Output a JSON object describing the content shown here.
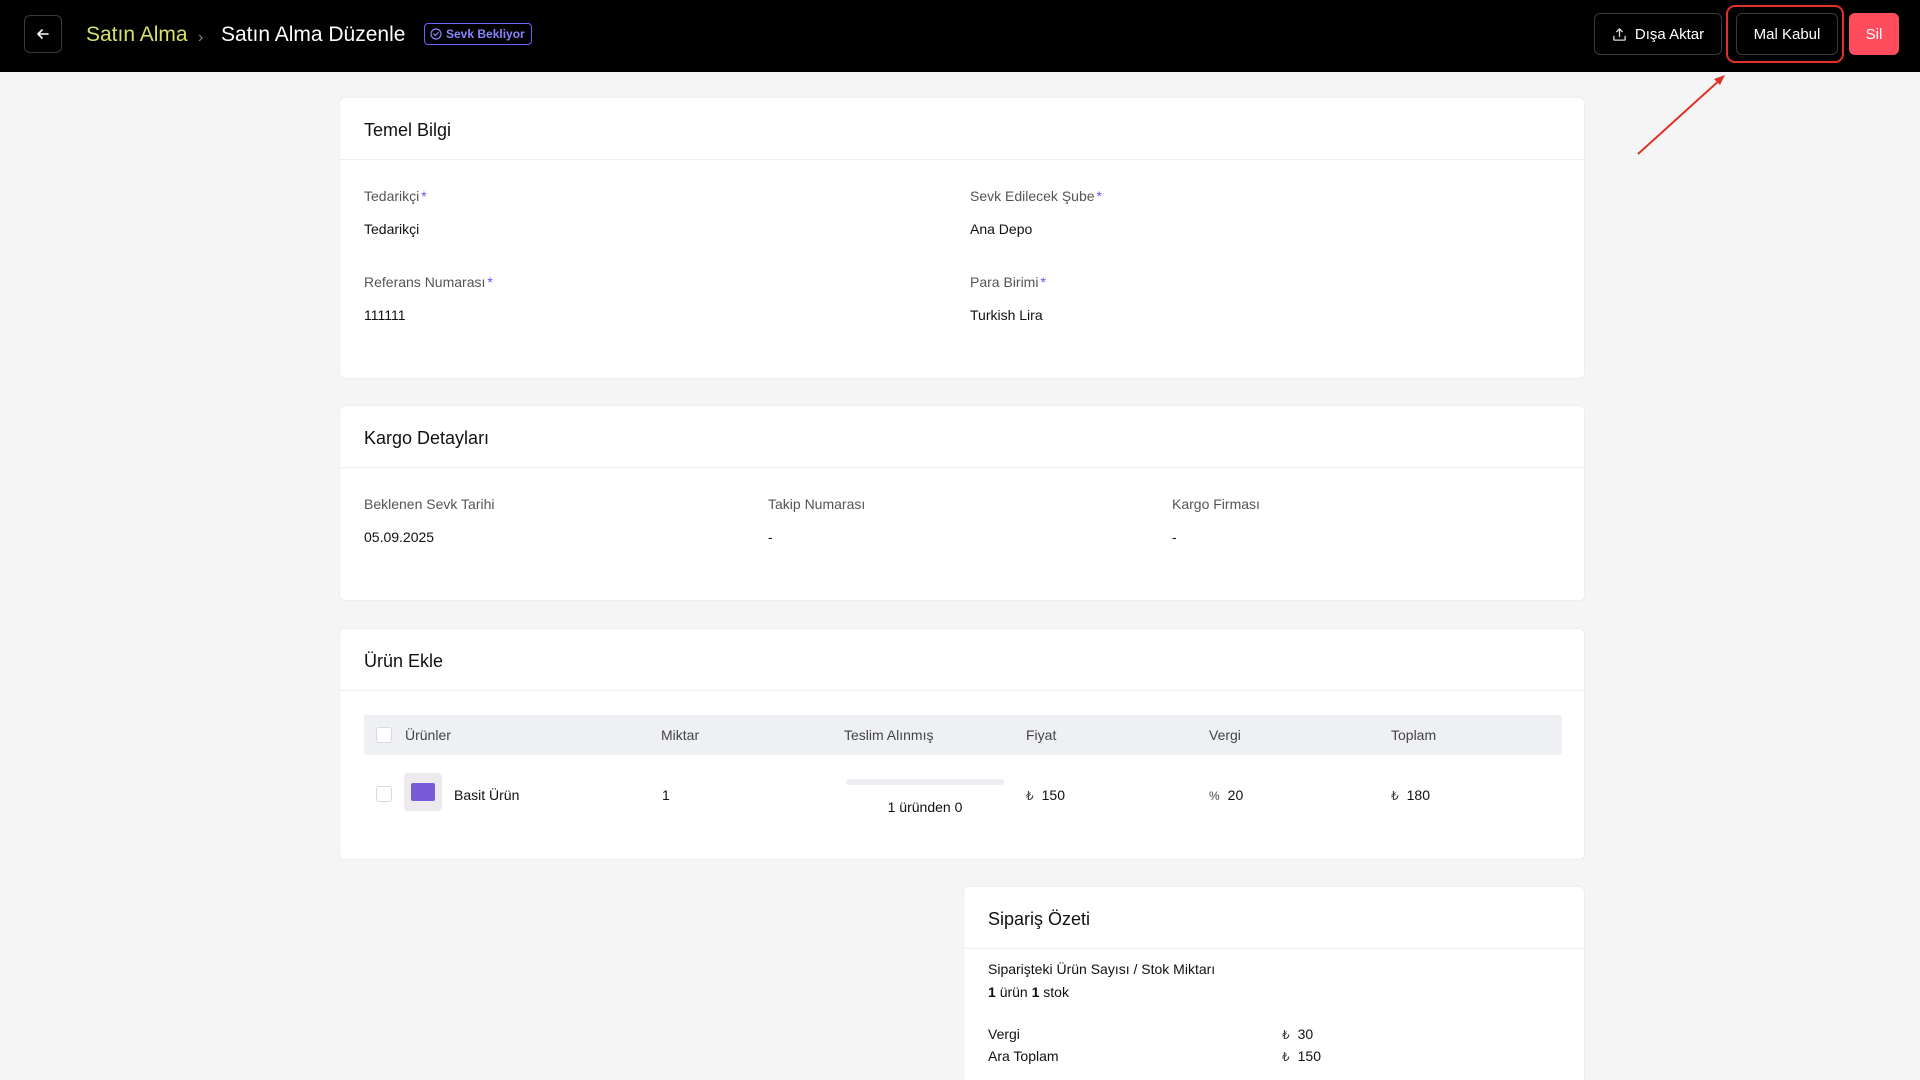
{
  "header": {
    "back_icon": "arrow-left-icon",
    "breadcrumb_parent": "Satın Alma",
    "breadcrumb_current": "Satın Alma Düzenle",
    "status_badge": "Sevk Bekliyor",
    "export_label": "Dışa Aktar",
    "accept_label": "Mal Kabul",
    "delete_label": "Sil"
  },
  "colors": {
    "topbar": "#000000",
    "breadcrumb_parent": "#d6e06a",
    "badge": "#6b63ff",
    "delete": "#ff4d5e",
    "highlight": "#e0302a"
  },
  "basic_info": {
    "title": "Temel Bilgi",
    "supplier_label": "Tedarikçi",
    "supplier_value": "Tedarikçi",
    "branch_label": "Sevk Edilecek Şube",
    "branch_value": "Ana Depo",
    "reference_label": "Referans Numarası",
    "reference_value": "111111",
    "currency_label": "Para Birimi",
    "currency_value": "Turkish Lira",
    "required_mark": "*"
  },
  "cargo": {
    "title": "Kargo Detayları",
    "date_label": "Beklenen Sevk Tarihi",
    "date_value": "05.09.2025",
    "tracking_label": "Takip Numarası",
    "tracking_value": "-",
    "company_label": "Kargo Firması",
    "company_value": "-"
  },
  "products": {
    "title": "Ürün Ekle",
    "columns": [
      "Ürünler",
      "Miktar",
      "Teslim Alınmış",
      "Fiyat",
      "Vergi",
      "Toplam"
    ],
    "rows": [
      {
        "name": "Basit Ürün",
        "quantity": "1",
        "received_text": "1 üründen 0",
        "received_fraction": 0,
        "price_symbol": "₺",
        "price": "150",
        "tax_symbol": "%",
        "tax": "20",
        "total_symbol": "₺",
        "total": "180"
      }
    ]
  },
  "summary": {
    "title": "Sipariş Özeti",
    "count_label": "Siparişteki Ürün Sayısı / Stok Miktarı",
    "product_count": "1",
    "product_word": "ürün",
    "stock_count": "1",
    "stock_word": "stok",
    "tax_label": "Vergi",
    "tax_symbol": "₺",
    "tax_value": "30",
    "subtotal_label": "Ara Toplam",
    "subtotal_symbol": "₺",
    "subtotal_value": "150"
  }
}
